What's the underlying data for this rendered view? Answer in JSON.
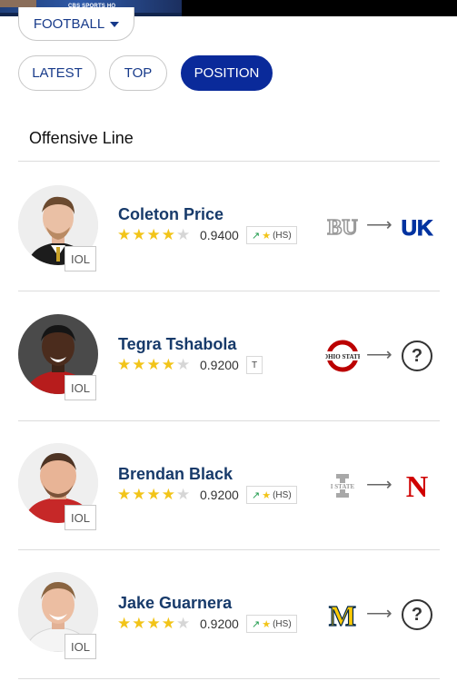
{
  "top_strip": {
    "video_label": "CBS SPORTS HQ"
  },
  "filters": {
    "sport_label": "FOOTBALL",
    "tabs": [
      {
        "label": "LATEST",
        "active": false
      },
      {
        "label": "TOP",
        "active": false
      },
      {
        "label": "POSITION",
        "active": true
      }
    ]
  },
  "section": {
    "title": "Offensive Line"
  },
  "players": [
    {
      "name": "Coleton Price",
      "stars": 4,
      "rating": "0.9400",
      "tag": "(HS)",
      "tag_trend": true,
      "position": "IOL",
      "from_school": "Baylor",
      "to_school": "Kentucky",
      "to_logo_text": "UK"
    },
    {
      "name": "Tegra Tshabola",
      "stars": 4,
      "rating": "0.9200",
      "tag": "T",
      "tag_trend": false,
      "position": "IOL",
      "from_school": "Ohio State",
      "to_school": "undecided"
    },
    {
      "name": "Brendan Black",
      "stars": 4,
      "rating": "0.9200",
      "tag": "(HS)",
      "tag_trend": true,
      "position": "IOL",
      "from_school": "Iowa State",
      "to_school": "Nebraska",
      "to_logo_text": "N"
    },
    {
      "name": "Jake Guarnera",
      "stars": 4,
      "rating": "0.9200",
      "tag": "(HS)",
      "tag_trend": true,
      "position": "IOL",
      "from_school": "Michigan",
      "to_school": "undecided"
    }
  ],
  "logo_text": {
    "baylor": "BU",
    "ohio_state": "OHIO STATE",
    "iowa_state": "I STATE",
    "michigan": "M"
  },
  "colors": {
    "brand_blue": "#0a2a9a",
    "name_blue": "#173a6a",
    "star_gold": "#f2c419",
    "trend_green": "#1e9a4b",
    "kentucky_blue": "#0033a0",
    "nebraska_red": "#d00000",
    "ohio_state_red": "#bb0000",
    "michigan_maize": "#ffcb05",
    "michigan_blue": "#00274c"
  }
}
